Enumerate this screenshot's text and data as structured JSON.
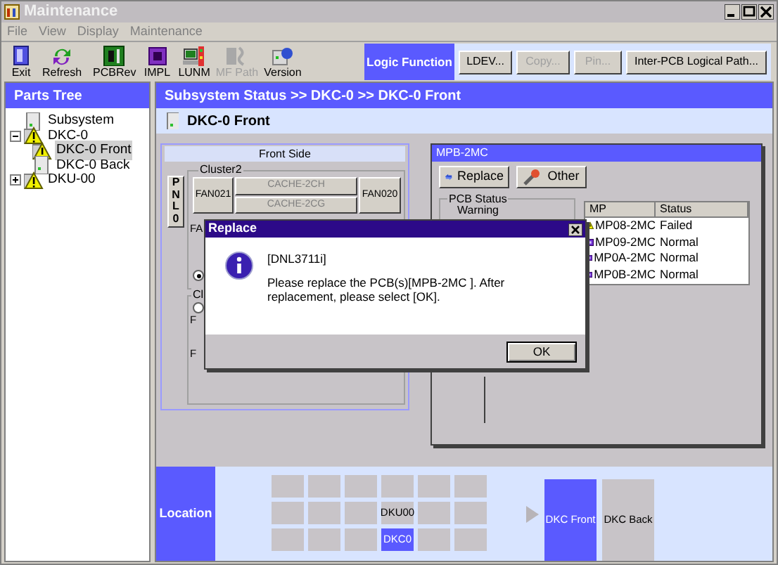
{
  "window": {
    "title": "Maintenance"
  },
  "menu": [
    {
      "label": "File"
    },
    {
      "label": "View"
    },
    {
      "label": "Display"
    },
    {
      "label": "Maintenance"
    }
  ],
  "toolbar": [
    {
      "label": "Exit",
      "disabled": false
    },
    {
      "label": "Refresh",
      "disabled": false
    },
    {
      "label": "PCBRev",
      "disabled": false
    },
    {
      "label": "IMPL",
      "disabled": false
    },
    {
      "label": "LUNM",
      "disabled": false
    },
    {
      "label": "MF Path",
      "disabled": true
    },
    {
      "label": "Version",
      "disabled": false
    }
  ],
  "logic_function": {
    "label": "Logic Function",
    "buttons": [
      {
        "label": "LDEV...",
        "disabled": false
      },
      {
        "label": "Copy...",
        "disabled": true
      },
      {
        "label": "Pin...",
        "disabled": true
      },
      {
        "label": "Inter-PCB Logical Path...",
        "disabled": false
      }
    ]
  },
  "parts_tree": {
    "title": "Parts Tree",
    "items": [
      {
        "label": "Subsystem",
        "kind": "plain",
        "selected": false
      },
      {
        "label": "DKC-0",
        "kind": "warning",
        "expanded": true,
        "selected": false,
        "children": [
          {
            "label": "DKC-0 Front",
            "kind": "warning",
            "selected": true
          },
          {
            "label": "DKC-0 Back",
            "kind": "plain",
            "selected": false
          }
        ]
      },
      {
        "label": "DKU-00",
        "kind": "warning",
        "expanded": false,
        "selected": false
      }
    ]
  },
  "breadcrumb": "Subsystem Status >> DKC-0 >> DKC-0 Front",
  "view_title": "DKC-0 Front",
  "front_side": {
    "title": "Front Side",
    "panel_button": "PNL0",
    "clusters": [
      {
        "label": "Cluster2",
        "cells": [
          {
            "label": "FAN021",
            "disabled": false
          },
          {
            "label": "CACHE-2CH",
            "disabled": true
          },
          {
            "label": "CACHE-2CG",
            "disabled": true
          },
          {
            "label": "FAN020",
            "disabled": false
          }
        ],
        "partial_labels": [
          "FA"
        ],
        "radio": {
          "selected": true
        }
      },
      {
        "label": "Cl",
        "partial_labels": [
          "F",
          "F"
        ],
        "radio": {
          "selected": false
        }
      }
    ]
  },
  "mpb_window": {
    "title": "MPB-2MC",
    "buttons": [
      {
        "label": "Replace"
      },
      {
        "label": "Other"
      }
    ],
    "pcb_status": {
      "title": "PCB Status",
      "value": "Warning"
    },
    "table": {
      "columns": [
        "MP",
        "Status"
      ],
      "rows": [
        {
          "mp": "MP08-2MC",
          "status": "Failed",
          "kind": "warning"
        },
        {
          "mp": "MP09-2MC",
          "status": "Normal",
          "kind": "normal"
        },
        {
          "mp": "MP0A-2MC",
          "status": "Normal",
          "kind": "normal"
        },
        {
          "mp": "MP0B-2MC",
          "status": "Normal",
          "kind": "normal"
        }
      ]
    }
  },
  "dialog": {
    "title": "Replace",
    "code": "[DNL3711i]",
    "message": "Please replace the PCB(s)[MPB-2MC ]. After replacement, please select [OK].",
    "ok": "OK"
  },
  "location": {
    "label": "Location",
    "grid": [
      [
        {
          "selected": false
        },
        {
          "selected": false
        },
        {
          "selected": false
        },
        {
          "selected": false
        },
        {
          "selected": false
        },
        {
          "selected": false
        }
      ],
      [
        {
          "selected": false
        },
        {
          "selected": false
        },
        {
          "selected": false
        },
        {
          "label": "DKU00",
          "selected": false
        },
        {
          "selected": false
        },
        {
          "selected": false
        }
      ],
      [
        {
          "selected": false
        },
        {
          "selected": false
        },
        {
          "selected": false
        },
        {
          "label": "DKC0",
          "selected": true
        },
        {
          "selected": false
        },
        {
          "selected": false
        }
      ]
    ],
    "views": [
      {
        "label": "DKC Front",
        "selected": true
      },
      {
        "label": "DKC Back",
        "selected": false
      }
    ]
  }
}
